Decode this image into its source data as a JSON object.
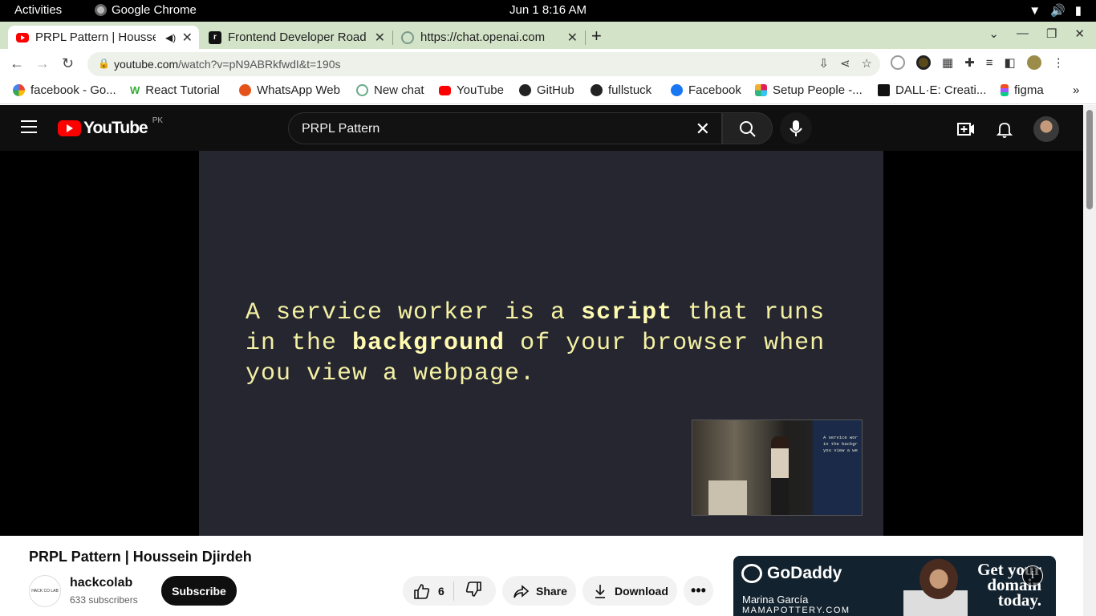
{
  "system": {
    "activities": "Activities",
    "app_name": "Google Chrome",
    "clock": "Jun 1   8:16 AM"
  },
  "tabs": [
    {
      "title": "PRPL Pattern | Housse",
      "icon": "youtube-icon",
      "active": true,
      "audio": true
    },
    {
      "title": "Frontend Developer Road",
      "icon": "roadmap-icon",
      "active": false
    },
    {
      "title": "https://chat.openai.com",
      "icon": "openai-icon",
      "active": false
    }
  ],
  "address": {
    "host": "youtube.com",
    "path": "/watch?v=pN9ABRkfwdI&t=190s"
  },
  "bookmarks": [
    {
      "label": "facebook - Go...",
      "icon": "google-icon"
    },
    {
      "label": "React Tutorial",
      "icon": "w3schools-icon"
    },
    {
      "label": "WhatsApp Web",
      "icon": "whatsapp-icon"
    },
    {
      "label": "New chat",
      "icon": "openai-icon"
    },
    {
      "label": "YouTube",
      "icon": "youtube-icon"
    },
    {
      "label": "GitHub",
      "icon": "github-icon"
    },
    {
      "label": "fullstuck",
      "icon": "github-icon"
    },
    {
      "label": "Facebook",
      "icon": "facebook-icon"
    },
    {
      "label": "Setup People -...",
      "icon": "slack-icon"
    },
    {
      "label": "DALL·E: Creati...",
      "icon": "openai-icon"
    },
    {
      "label": "figma",
      "icon": "figma-icon"
    }
  ],
  "youtube": {
    "logo_text": "YouTube",
    "country_code": "PK",
    "search_query": "PRPL Pattern"
  },
  "slide": {
    "l1a": "A service worker is a ",
    "l1b": "script",
    "l1c": " that runs",
    "l2a": "in the ",
    "l2b": "background",
    "l2c": " of your browser when",
    "l3": "you view a webpage.",
    "pip_l1": "A service wor",
    "pip_l2": "in the backgr",
    "pip_l3": "you view a we"
  },
  "video": {
    "title": "PRPL Pattern | Houssein Djirdeh",
    "channel": "hackcolab",
    "channel_avatar_text": "HACK CO LAB",
    "subscribers": "633 subscribers",
    "subscribe_label": "Subscribe",
    "likes": "6",
    "share_label": "Share",
    "download_label": "Download"
  },
  "ad": {
    "brand": "GoDaddy",
    "name": "Marina García",
    "site": "MAMAPOTTERY.COM",
    "cta1": "Get your",
    "cta2": "domain",
    "cta3": "today."
  }
}
